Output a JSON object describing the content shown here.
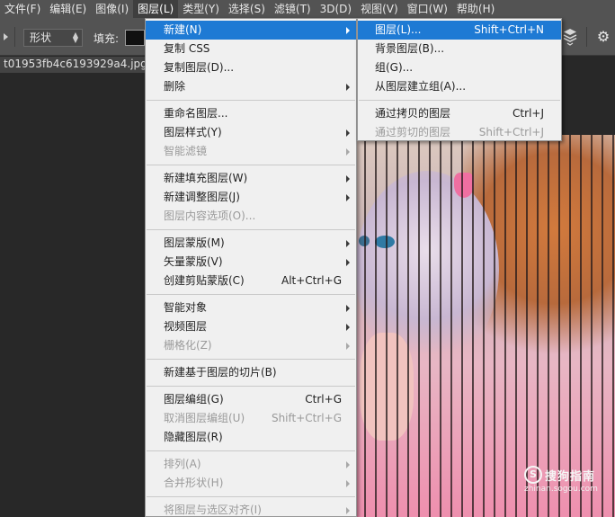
{
  "menubar": {
    "items": [
      "文件(F)",
      "编辑(E)",
      "图像(I)",
      "图层(L)",
      "类型(Y)",
      "选择(S)",
      "滤镜(T)",
      "3D(D)",
      "视图(V)",
      "窗口(W)",
      "帮助(H)"
    ],
    "active_index": 3
  },
  "options_bar": {
    "shape_mode": "形状",
    "fill_label": "填充:",
    "fill_color": "#111111"
  },
  "document_tab": {
    "title": "t01953fb4c6193929a4.jpg @"
  },
  "layer_menu": {
    "groups": [
      [
        {
          "label": "新建(N)",
          "submenu": true,
          "highlighted": true
        },
        {
          "label": "复制 CSS"
        },
        {
          "label": "复制图层(D)..."
        },
        {
          "label": "删除",
          "submenu": true
        }
      ],
      [
        {
          "label": "重命名图层..."
        },
        {
          "label": "图层样式(Y)",
          "submenu": true
        },
        {
          "label": "智能滤镜",
          "submenu": true,
          "disabled": true
        }
      ],
      [
        {
          "label": "新建填充图层(W)",
          "submenu": true
        },
        {
          "label": "新建调整图层(J)",
          "submenu": true
        },
        {
          "label": "图层内容选项(O)...",
          "disabled": true
        }
      ],
      [
        {
          "label": "图层蒙版(M)",
          "submenu": true
        },
        {
          "label": "矢量蒙版(V)",
          "submenu": true
        },
        {
          "label": "创建剪贴蒙版(C)",
          "shortcut": "Alt+Ctrl+G"
        }
      ],
      [
        {
          "label": "智能对象",
          "submenu": true
        },
        {
          "label": "视频图层",
          "submenu": true
        },
        {
          "label": "栅格化(Z)",
          "submenu": true,
          "disabled": true
        }
      ],
      [
        {
          "label": "新建基于图层的切片(B)"
        }
      ],
      [
        {
          "label": "图层编组(G)",
          "shortcut": "Ctrl+G"
        },
        {
          "label": "取消图层编组(U)",
          "shortcut": "Shift+Ctrl+G",
          "disabled": true
        },
        {
          "label": "隐藏图层(R)"
        }
      ],
      [
        {
          "label": "排列(A)",
          "submenu": true,
          "disabled": true
        },
        {
          "label": "合并形状(H)",
          "submenu": true,
          "disabled": true
        }
      ],
      [
        {
          "label": "将图层与选区对齐(I)",
          "submenu": true,
          "disabled": true
        }
      ]
    ]
  },
  "new_submenu": {
    "groups": [
      [
        {
          "label": "图层(L)...",
          "shortcut": "Shift+Ctrl+N",
          "highlighted": true
        },
        {
          "label": "背景图层(B)..."
        },
        {
          "label": "组(G)..."
        },
        {
          "label": "从图层建立组(A)..."
        }
      ],
      [
        {
          "label": "通过拷贝的图层",
          "shortcut": "Ctrl+J"
        },
        {
          "label": "通过剪切的图层",
          "shortcut": "Shift+Ctrl+J",
          "disabled": true
        }
      ]
    ]
  },
  "watermark": {
    "brand": "搜狗指南",
    "url": "zhinan.sogou.com",
    "logo_letter": "S"
  }
}
